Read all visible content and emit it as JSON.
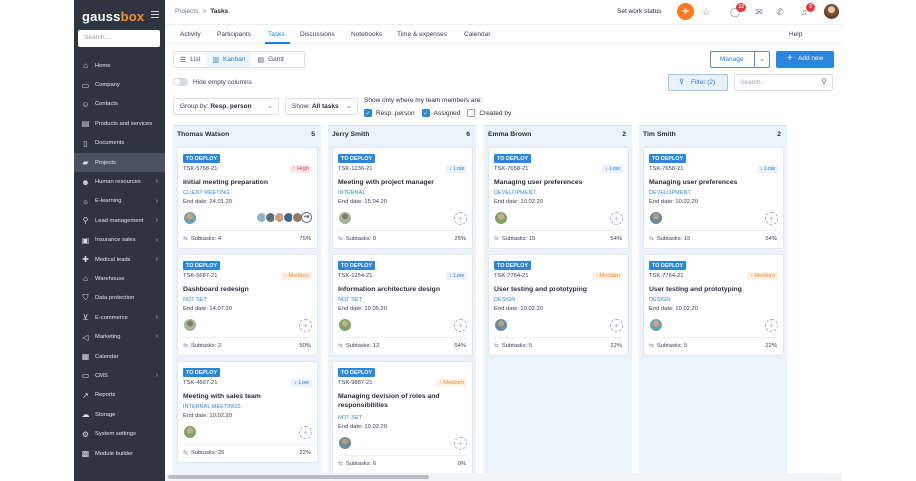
{
  "app": {
    "logo_main": "gauss",
    "logo_accent": "box"
  },
  "sidebar": {
    "search_placeholder": "Search...",
    "items": [
      {
        "label": "Home",
        "icon": "home-icon",
        "glyph": "⌂",
        "chevron": ""
      },
      {
        "label": "Company",
        "icon": "briefcase-icon",
        "glyph": "▭",
        "chevron": ""
      },
      {
        "label": "Contacts",
        "icon": "contacts-icon",
        "glyph": "☺",
        "chevron": ""
      },
      {
        "label": "Products and services",
        "icon": "products-icon",
        "glyph": "▤",
        "chevron": ""
      },
      {
        "label": "Documents",
        "icon": "document-icon",
        "glyph": "▯",
        "chevron": ""
      },
      {
        "label": "Projects",
        "icon": "folder-icon",
        "glyph": "▰",
        "chevron": ""
      },
      {
        "label": "Human resources",
        "icon": "people-icon",
        "glyph": "☻",
        "chevron": "›"
      },
      {
        "label": "E-learning",
        "icon": "lightbulb-icon",
        "glyph": "☼",
        "chevron": "›"
      },
      {
        "label": "Lead management",
        "icon": "lead-icon",
        "glyph": "⚲",
        "chevron": "›"
      },
      {
        "label": "Insurance sales",
        "icon": "insurance-icon",
        "glyph": "▣",
        "chevron": "›"
      },
      {
        "label": "Medical leads",
        "icon": "medical-icon",
        "glyph": "✚",
        "chevron": "›"
      },
      {
        "label": "Warehouse",
        "icon": "warehouse-icon",
        "glyph": "⌂",
        "chevron": ""
      },
      {
        "label": "Data protection",
        "icon": "shield-icon",
        "glyph": "⛉",
        "chevron": ""
      },
      {
        "label": "E-commerce",
        "icon": "cart-icon",
        "glyph": "⊻",
        "chevron": "›"
      },
      {
        "label": "Marketing",
        "icon": "megaphone-icon",
        "glyph": "◁",
        "chevron": "›"
      },
      {
        "label": "Calendar",
        "icon": "calendar-icon",
        "glyph": "▦",
        "chevron": ""
      },
      {
        "label": "CMS",
        "icon": "monitor-icon",
        "glyph": "▭",
        "chevron": "›"
      },
      {
        "label": "Reports",
        "icon": "chart-icon",
        "glyph": "↗",
        "chevron": ""
      },
      {
        "label": "Storage",
        "icon": "cloud-icon",
        "glyph": "☁",
        "chevron": ""
      },
      {
        "label": "System settings",
        "icon": "gear-icon",
        "glyph": "⚙",
        "chevron": ""
      },
      {
        "label": "Module builder",
        "icon": "module-icon",
        "glyph": "▩",
        "chevron": ""
      }
    ],
    "active_label": "Projects"
  },
  "topbar": {
    "crumb_parent": "Projects",
    "crumb_sep": ">",
    "crumb_current": "Tasks",
    "work_status": "Set work status",
    "plus": "+",
    "icons": [
      {
        "name": "star-icon",
        "glyph": "☆",
        "badge": ""
      },
      {
        "name": "chat-icon",
        "glyph": "◯",
        "badge": "12"
      },
      {
        "name": "mail-icon",
        "glyph": "✉",
        "badge": ""
      },
      {
        "name": "phone-icon",
        "glyph": "✆",
        "badge": ""
      },
      {
        "name": "bell-icon",
        "glyph": "♫",
        "badge": "3"
      }
    ]
  },
  "tabs": {
    "items": [
      "Activity",
      "Participants",
      "Tasks",
      "Discussions",
      "Notebooks",
      "Time & expenses",
      "Calendar"
    ],
    "active": "Tasks",
    "help": "Help"
  },
  "toolbar": {
    "views": [
      {
        "label": "List",
        "glyph": "☰",
        "icon": "list-icon"
      },
      {
        "label": "Kanban",
        "glyph": "▥",
        "icon": "kanban-icon"
      },
      {
        "label": "Gantt",
        "glyph": "▤",
        "icon": "gantt-icon"
      }
    ],
    "active_view": "Kanban",
    "manage": "Manage",
    "add_new": "Add new",
    "hide_empty": "Hide empty columns",
    "filter": "Filter (2)",
    "search_placeholder": "Search...",
    "group_by_label": "Group by:",
    "group_by_value": "Resp. person",
    "show_label": "Show:",
    "show_value": "All tasks",
    "only_show_label": "Show only where my team members are:",
    "checks": [
      {
        "label": "Resp. person",
        "checked": true
      },
      {
        "label": "Assigned",
        "checked": true
      },
      {
        "label": "Created by",
        "checked": false
      }
    ]
  },
  "board": {
    "columns": [
      {
        "name": "Thomas Watson",
        "count": "5",
        "cards": [
          {
            "status": "TO DEPLOY",
            "id": "TSK-5768-21",
            "priority": "High",
            "title": "Initial meeting preparation",
            "category": "CLIENT MEETING",
            "end": "End date: 24.01.20",
            "subtasks": "Subtasks: 4",
            "progress": "75%",
            "group_more": "+6"
          },
          {
            "status": "TO DEPLOY",
            "id": "TSK-5687-21",
            "priority": "Medium",
            "title": "Dashboard redesign",
            "category": "NOT SET",
            "end": "End date: 14.07.20",
            "subtasks": "Subtasks: 2",
            "progress": "50%"
          },
          {
            "status": "TO DEPLOY",
            "id": "TSK-4567-21",
            "priority": "Low",
            "title": "Meeting with sales team",
            "category": "INTERNAL MEETINGS",
            "end": "End date: 10.02.20",
            "subtasks": "Subtasks: 25",
            "progress": "22%"
          }
        ]
      },
      {
        "name": "Jerry Smith",
        "count": "6",
        "cards": [
          {
            "status": "TO DEPLOY",
            "id": "TSK-1236-21",
            "priority": "Low",
            "title": "Meeting with project manager",
            "category": "INTERNAL",
            "end": "End date: 15.04.20",
            "subtasks": "Subtasks: 0",
            "progress": "25%"
          },
          {
            "status": "TO DEPLOY",
            "id": "TSK-1254-21",
            "priority": "Low",
            "title": "Information architecture design",
            "category": "NOT SET",
            "end": "End date: 10.05.20",
            "subtasks": "Subtasks: 12",
            "progress": "54%"
          },
          {
            "status": "TO DEPLOY",
            "id": "TSK-9887-21",
            "priority": "Medium",
            "title": "Managing devision of roles and responsibilities",
            "category": "NOT SET",
            "end": "End date: 10.02.20",
            "subtasks": "Subtasks: 6",
            "progress": "0%"
          }
        ]
      },
      {
        "name": "Emma Brown",
        "count": "2",
        "cards": [
          {
            "status": "TO DEPLOY",
            "id": "TSK-7658-21",
            "priority": "Low",
            "title": "Managing user preferences",
            "category": "DEVELOPMENT",
            "end": "End date: 10.02.20",
            "subtasks": "Subtasks: 15",
            "progress": "54%"
          },
          {
            "status": "TO DEPLOY",
            "id": "TSK-7764-21",
            "priority": "Medium",
            "title": "User testing and prototyping",
            "category": "DESIGN",
            "end": "End date: 10.02.20",
            "subtasks": "Subtasks: 5",
            "progress": "22%"
          }
        ]
      },
      {
        "name": "Tim Smith",
        "count": "2",
        "cards": [
          {
            "status": "TO DEPLOY",
            "id": "TSK-7658-21",
            "priority": "Low",
            "title": "Managing user preferences",
            "category": "DEVELOPMENT",
            "end": "End date: 10.02.20",
            "subtasks": "Subtasks: 15",
            "progress": "54%"
          },
          {
            "status": "TO DEPLOY",
            "id": "TSK-7764-21",
            "priority": "Medium",
            "title": "User testing and prototyping",
            "category": "DESIGN",
            "end": "End date: 10.02.20",
            "subtasks": "Subtasks: 5",
            "progress": "22%"
          }
        ]
      }
    ]
  },
  "colors": {
    "sidebar_bg": "#2e3440",
    "accent": "#2b86de",
    "orange": "#ff7a1a",
    "high": "#e5393b",
    "medium": "#ef8b2c",
    "column_bg": "#eaf2fb"
  }
}
